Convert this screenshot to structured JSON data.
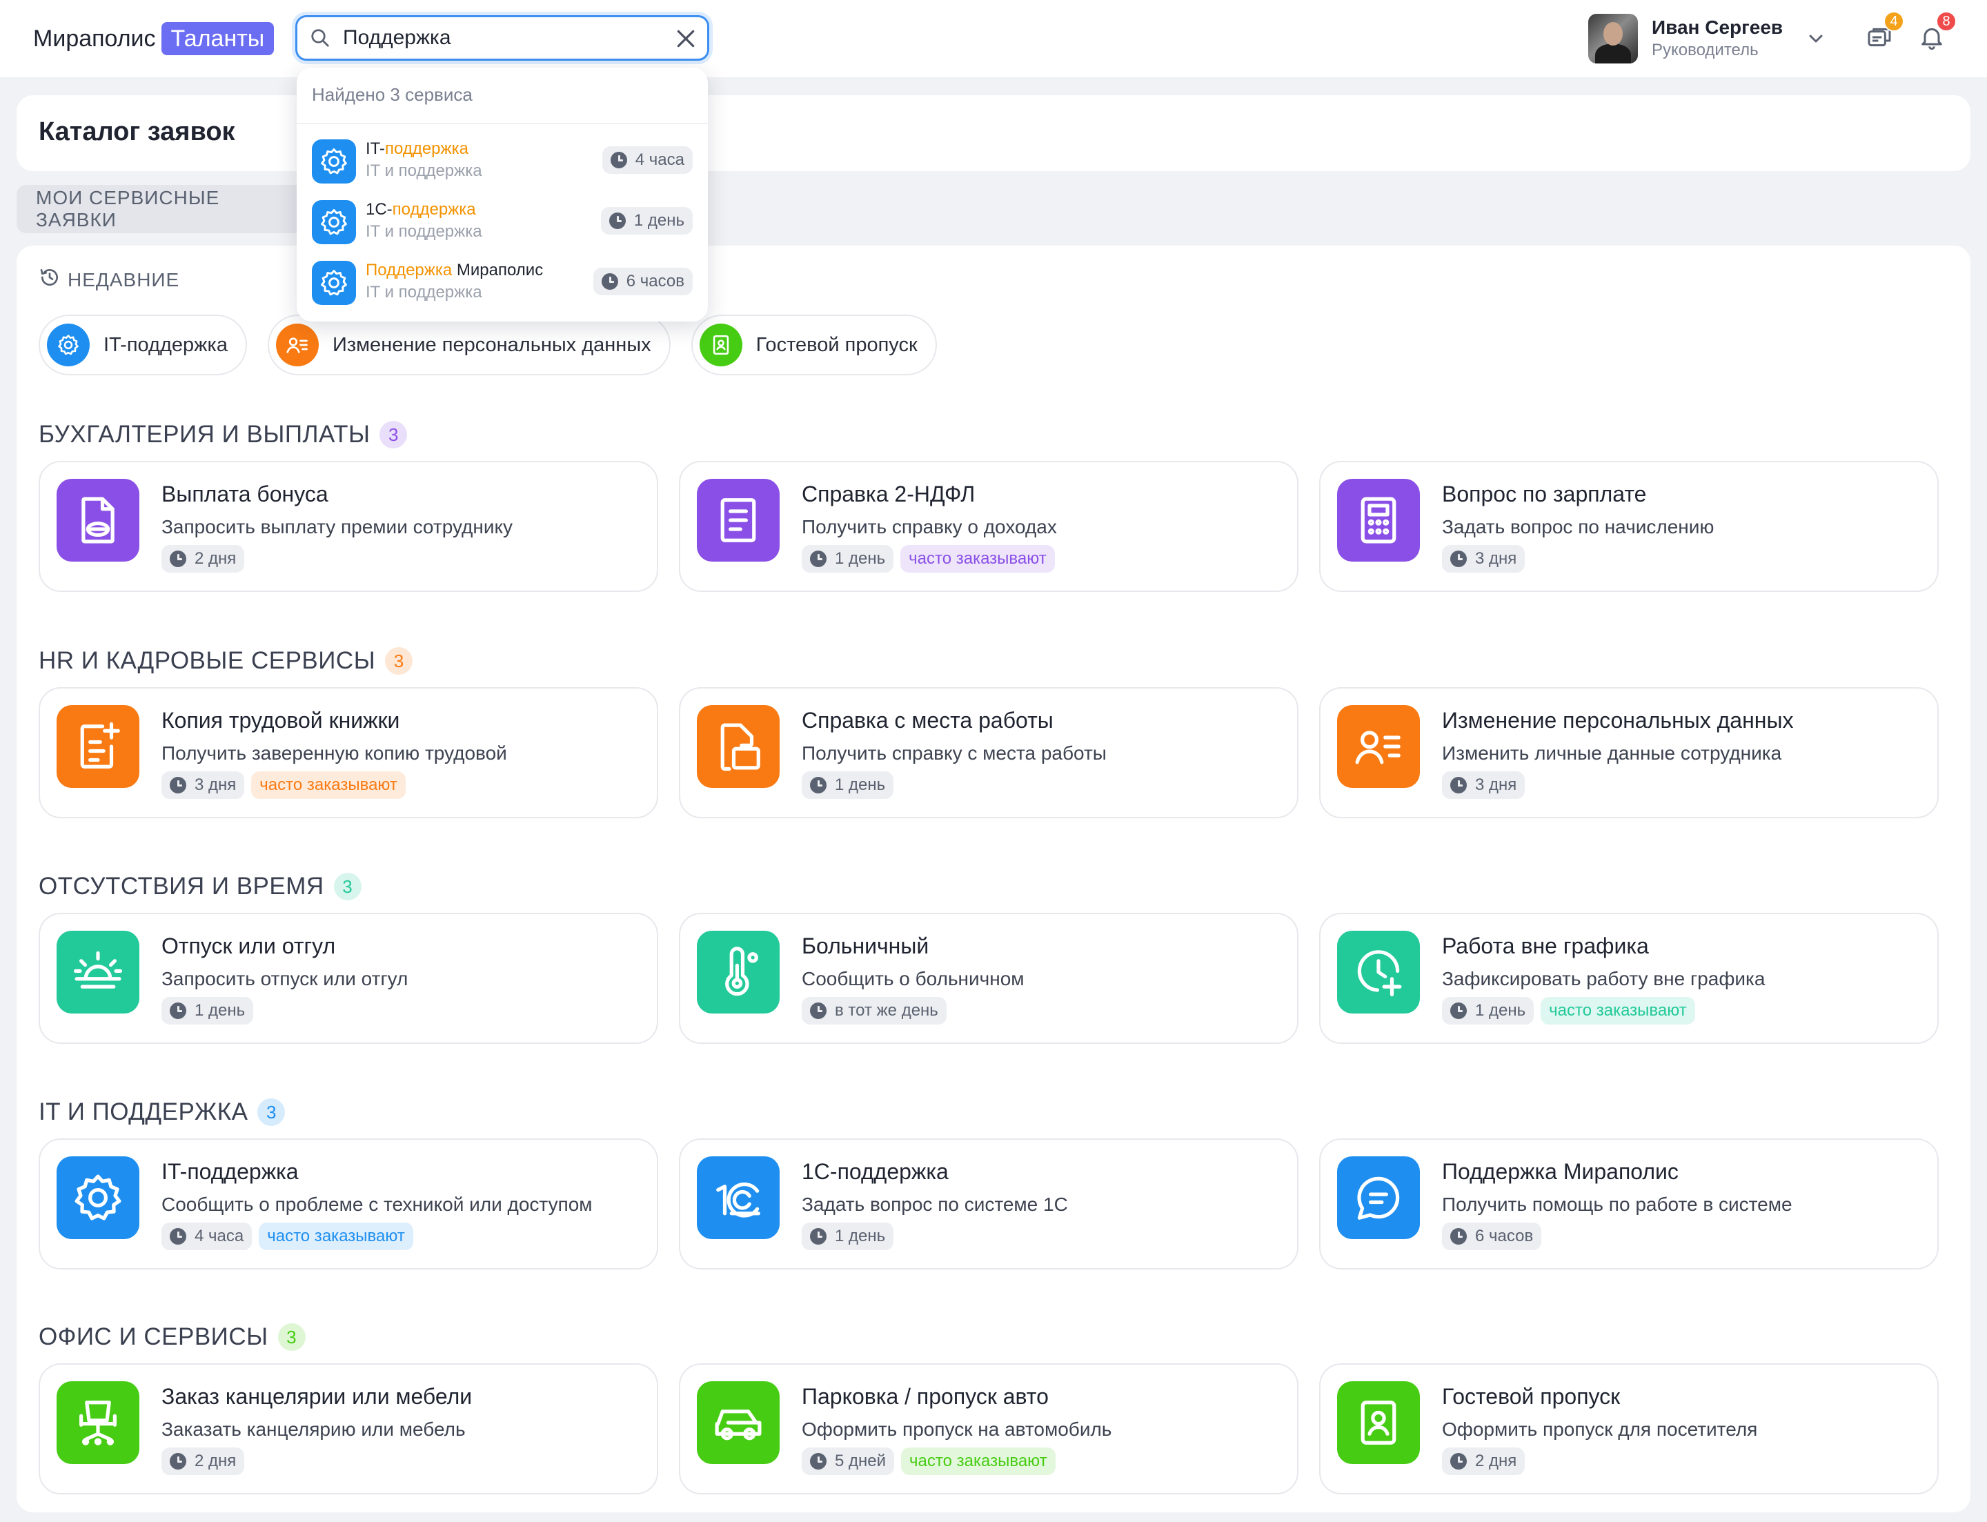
{
  "header": {
    "logo_text": "Мираполис",
    "logo_tag": "Таланты",
    "search_value": "Поддержка",
    "user_name": "Иван Сергеев",
    "user_role": "Руководитель",
    "messages_badge": "4",
    "notifications_badge": "8"
  },
  "search_dropdown": {
    "found_text": "Найдено 3 сервиса",
    "results": [
      {
        "prefix": "IT-",
        "match": "поддержка",
        "suffix": "",
        "sub": "IT и поддержка",
        "time": "4 часа"
      },
      {
        "prefix": "1С-",
        "match": "поддержка",
        "suffix": "",
        "sub": "IT и поддержка",
        "time": "1 день"
      },
      {
        "prefix": "",
        "match": "Поддержка",
        "suffix": " Мираполис",
        "sub": "IT и поддержка",
        "time": "6 часов"
      }
    ]
  },
  "page": {
    "title": "Каталог заявок",
    "my_requests_tab": "МОИ СЕРВИСНЫЕ ЗАЯВКИ"
  },
  "recent": {
    "label": "НЕДАВНИЕ",
    "items": [
      "IT-поддержка",
      "Изменение персональных данных",
      "Гостевой пропуск"
    ]
  },
  "popular_tag": "часто заказывают",
  "sections": [
    {
      "title": "БУХГАЛТЕРИЯ И ВЫПЛАТЫ",
      "count": "3",
      "color": "#8a4fe6",
      "cards": [
        {
          "title": "Выплата бонуса",
          "desc": "Запросить выплату премии сотруднику",
          "time": "2 дня",
          "icon": "bonus-document-icon"
        },
        {
          "title": "Справка 2-НДФЛ",
          "desc": "Получить справку о доходах",
          "time": "1 день",
          "icon": "document-icon",
          "popular": true
        },
        {
          "title": "Вопрос по зарплате",
          "desc": "Задать вопрос по начислению",
          "time": "3 дня",
          "icon": "calculator-icon"
        }
      ]
    },
    {
      "title": "HR И КАДРОВЫЕ СЕРВИСЫ",
      "count": "3",
      "color": "#f97a12",
      "cards": [
        {
          "title": "Копия трудовой книжки",
          "desc": "Получить заверенную копию трудовой",
          "time": "3 дня",
          "icon": "document-plus-icon",
          "popular": true
        },
        {
          "title": "Справка с места работы",
          "desc": "Получить справку с места работы",
          "time": "1 день",
          "icon": "briefcase-document-icon"
        },
        {
          "title": "Изменение персональных данных",
          "desc": "Изменить личные данные сотрудника",
          "time": "3 дня",
          "icon": "person-list-icon"
        }
      ]
    },
    {
      "title": "ОТСУТСТВИЯ И ВРЕМЯ",
      "count": "3",
      "color": "#22c999",
      "cards": [
        {
          "title": "Отпуск или отгул",
          "desc": "Запросить отпуск или отгул",
          "time": "1 день",
          "icon": "sunset-icon"
        },
        {
          "title": "Больничный",
          "desc": "Сообщить о больничном",
          "time": "в тот же день",
          "icon": "thermometer-icon"
        },
        {
          "title": "Работа вне графика",
          "desc": "Зафиксировать работу вне графика",
          "time": "1 день",
          "icon": "clock-plus-icon",
          "popular": true
        }
      ]
    },
    {
      "title": "IT И ПОДДЕРЖКА",
      "count": "3",
      "color": "#1e8ff0",
      "cards": [
        {
          "title": "IT-поддержка",
          "desc": "Сообщить о проблеме с техникой или доступом",
          "time": "4 часа",
          "icon": "gear-icon",
          "popular": true
        },
        {
          "title": "1С-поддержка",
          "desc": "Задать вопрос по системе 1С",
          "time": "1 день",
          "icon": "1c-logo-icon"
        },
        {
          "title": "Поддержка Мираполис",
          "desc": "Получить помощь по работе в системе",
          "time": "6 часов",
          "icon": "chat-bubble-icon"
        }
      ]
    },
    {
      "title": "ОФИС И СЕРВИСЫ",
      "count": "3",
      "color": "#46cc12",
      "cards": [
        {
          "title": "Заказ канцелярии или мебели",
          "desc": "Заказать канцелярию или мебель",
          "time": "2 дня",
          "icon": "office-chair-icon"
        },
        {
          "title": "Парковка / пропуск авто",
          "desc": "Оформить пропуск на автомобиль",
          "time": "5 дней",
          "icon": "car-icon",
          "popular": true
        },
        {
          "title": "Гостевой пропуск",
          "desc": "Оформить пропуск для посетителя",
          "time": "2 дня",
          "icon": "badge-icon"
        }
      ]
    }
  ]
}
